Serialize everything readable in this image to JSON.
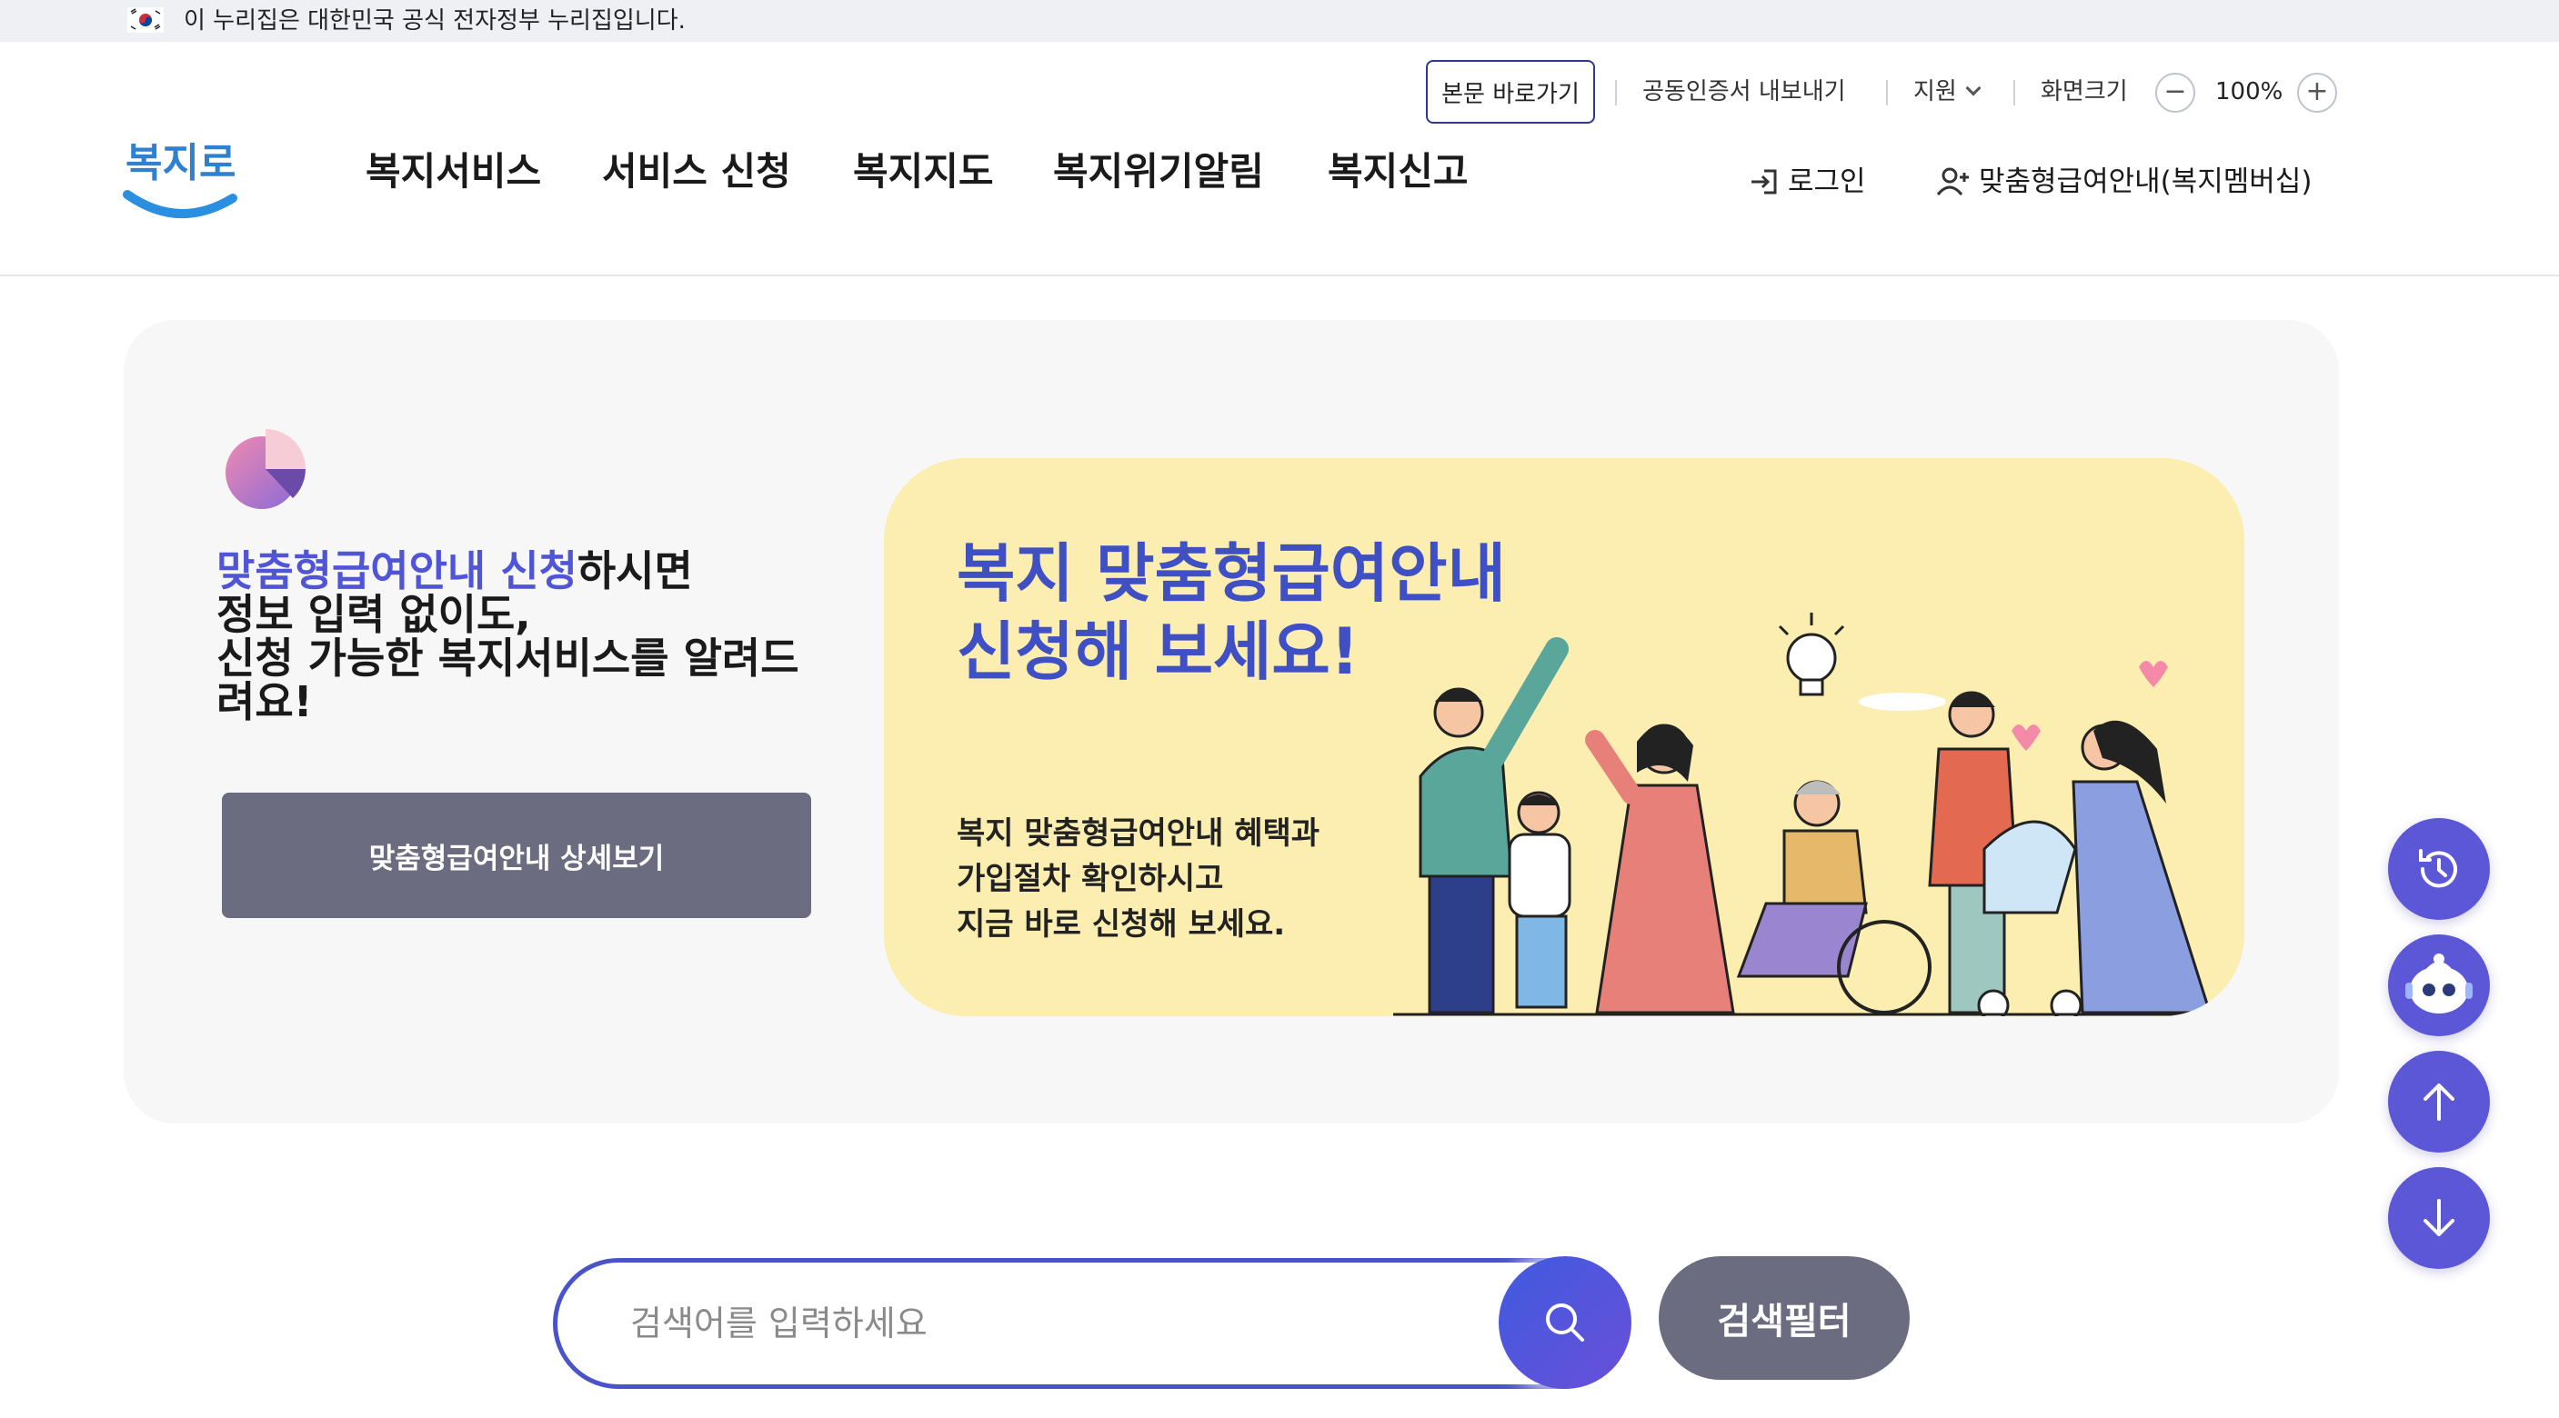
{
  "gov_strip": {
    "text": "이 누리집은 대한민국 공식 전자정부 누리집입니다."
  },
  "utility": {
    "skip_link": "본문 바로가기",
    "cert_export": "공동인증서 내보내기",
    "support": "지원",
    "screen_size": "화면크기",
    "zoom_minus": "−",
    "zoom_value": "100%",
    "zoom_plus": "+"
  },
  "logo": {
    "text": "복지로"
  },
  "gnb": [
    {
      "label": "복지서비스"
    },
    {
      "label": "서비스 신청"
    },
    {
      "label": "복지지도"
    },
    {
      "label": "복지위기알림"
    },
    {
      "label": "복지신고"
    }
  ],
  "account": {
    "login": "로그인",
    "membership": "맞춤형급여안내(복지멤버십)"
  },
  "hero": {
    "title_highlight": "맞춤형급여안내 신청",
    "title_rest": "하시면",
    "title_line2": "정보 입력 없이도,",
    "title_line3": "신청 가능한 복지서비스를 알려드려요!",
    "detail_button": "맞춤형급여안내 상세보기"
  },
  "banner": {
    "title_line1": "복지 맞춤형급여안내",
    "title_line2": "신청해 보세요!",
    "desc_line1": "복지 맞춤형급여안내 혜택과",
    "desc_line2": "가입절차 확인하시고",
    "desc_line3": "지금 바로 신청해 보세요."
  },
  "floating": [
    {
      "icon": "history-icon"
    },
    {
      "icon": "chatbot-icon"
    },
    {
      "icon": "arrow-up-icon"
    },
    {
      "icon": "arrow-down-icon"
    }
  ],
  "search": {
    "placeholder": "검색어를 입력하세요",
    "value": "",
    "filter_button": "검색필터"
  },
  "colors": {
    "accent": "#4f55d6",
    "banner_bg": "#fbeeb0",
    "button_gray": "#6b6c80",
    "fab": "#5b57d6"
  }
}
